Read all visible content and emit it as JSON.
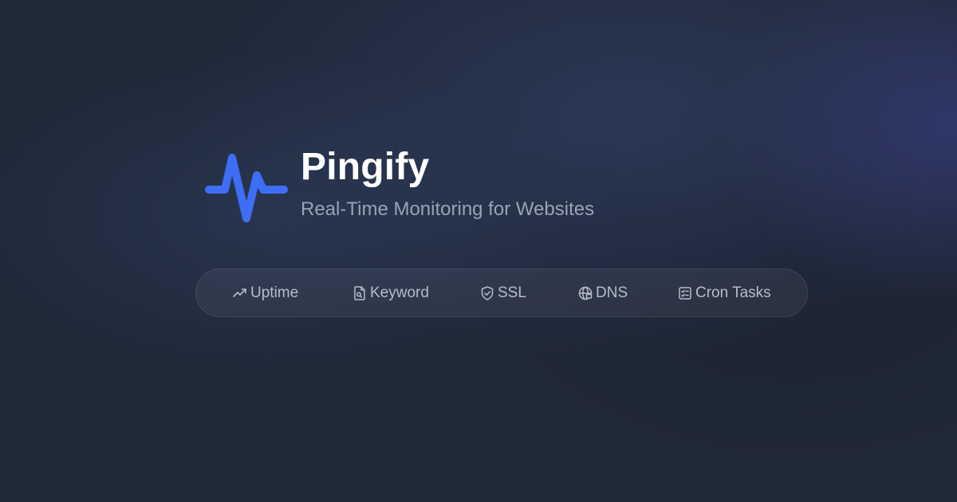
{
  "brand": {
    "name": "Pingify",
    "tagline": "Real-Time Monitoring for Websites",
    "logo_icon": "pulse-icon",
    "accent_color": "#3d6ef5"
  },
  "features": [
    {
      "label": "Uptime",
      "icon": "trending-up-icon"
    },
    {
      "label": "Keyword",
      "icon": "file-search-icon"
    },
    {
      "label": "SSL",
      "icon": "shield-check-icon"
    },
    {
      "label": "DNS",
      "icon": "globe-icon"
    },
    {
      "label": "Cron Tasks",
      "icon": "checklist-icon"
    }
  ]
}
